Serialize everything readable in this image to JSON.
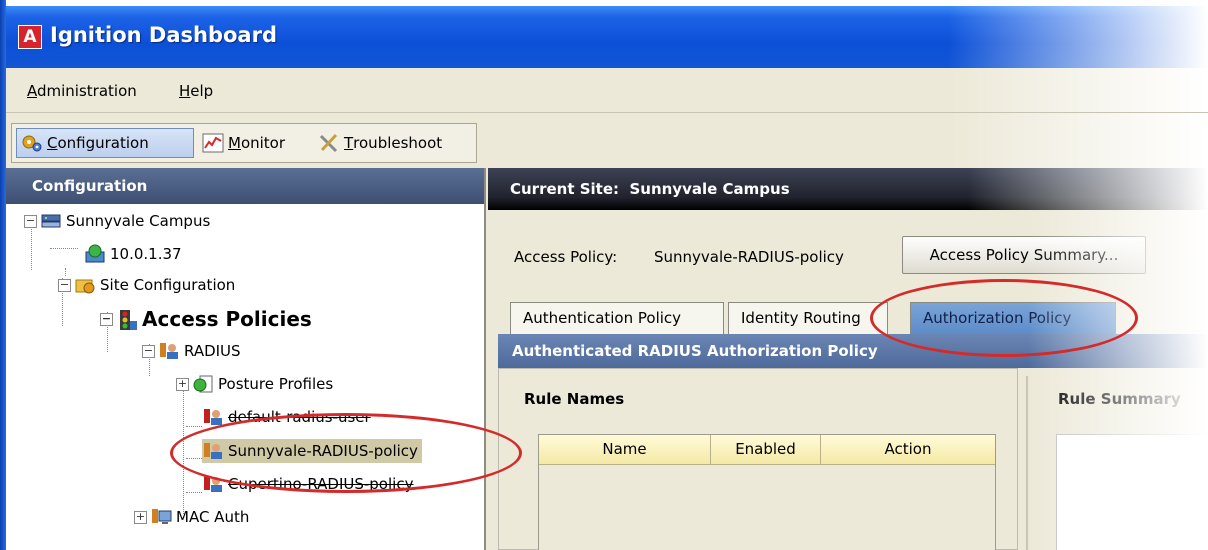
{
  "app": {
    "title": "Ignition Dashboard",
    "logo_letter": "A"
  },
  "menu": [
    {
      "label": "Administration",
      "mnemonic": "A",
      "rest": "dministration"
    },
    {
      "label": "Help",
      "mnemonic": "H",
      "rest": "elp"
    }
  ],
  "toolbar": [
    {
      "label": "Configuration",
      "mnemonic": "C",
      "rest": "onfiguration",
      "active": true,
      "icon": "gears-icon"
    },
    {
      "label": "Monitor",
      "mnemonic": "M",
      "rest": "onitor",
      "active": false,
      "icon": "chart-icon"
    },
    {
      "label": "Troubleshoot",
      "mnemonic": "T",
      "rest": "roubleshoot",
      "active": false,
      "icon": "tools-icon"
    }
  ],
  "left_panel": {
    "title": "Configuration"
  },
  "tree": [
    {
      "label": "Sunnyvale Campus",
      "icon": "network-icon",
      "expander": "−"
    },
    {
      "label": "10.0.1.37",
      "icon": "server-icon"
    },
    {
      "label": "Site Configuration",
      "icon": "folder-gear-icon",
      "expander": "−"
    },
    {
      "label": "Access Policies",
      "icon": "traffic-light-icon",
      "expander": "−"
    },
    {
      "label": "RADIUS",
      "icon": "users-icon",
      "expander": "−"
    },
    {
      "label": "Posture Profiles",
      "icon": "posture-icon",
      "expander": "+"
    },
    {
      "label": "default-radius-user",
      "icon": "policy-icon"
    },
    {
      "label": "Sunnyvale-RADIUS-policy",
      "icon": "policy-icon",
      "selected": true
    },
    {
      "label": "Cupertino-RADIUS-policy",
      "icon": "policy-icon"
    },
    {
      "label": "MAC Auth",
      "icon": "monitor-icon",
      "expander": "+"
    }
  ],
  "site": {
    "label": "Current Site:",
    "name": "Sunnyvale Campus"
  },
  "access_policy": {
    "label": "Access Policy:",
    "value": "Sunnyvale-RADIUS-policy",
    "button": "Access Policy Summary..."
  },
  "tabs": [
    {
      "label": "Authentication Policy",
      "active": false
    },
    {
      "label": "Identity Routing",
      "active": false
    },
    {
      "label": "Authorization Policy",
      "active": true
    }
  ],
  "policy_header": "Authenticated RADIUS Authorization Policy",
  "rule_names_label": "Rule Names",
  "rule_summary_label": "Rule Summary",
  "rule_table": {
    "columns": [
      "Name",
      "Enabled",
      "Action"
    ],
    "rows": []
  },
  "colors": {
    "annotation": "#d42a2a",
    "title_bar": "#0c50d8",
    "tab_active": "#5d8cc8"
  }
}
